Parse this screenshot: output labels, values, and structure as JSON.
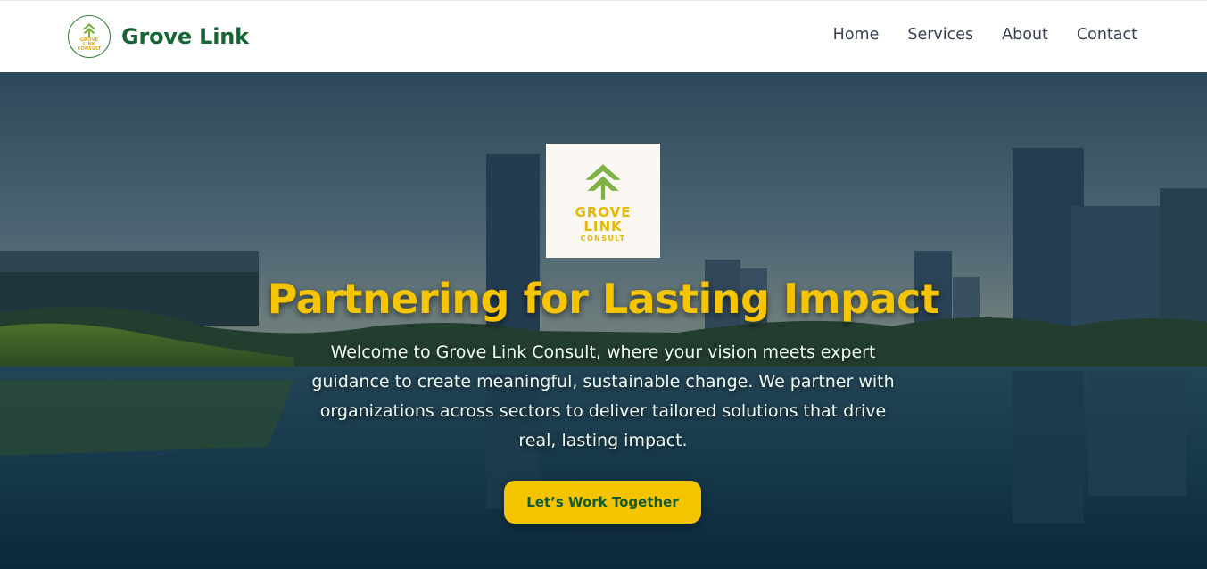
{
  "brand": {
    "name": "Grove Link",
    "badge_words": [
      "GROVE",
      "LINK",
      "CONSULT"
    ]
  },
  "nav": {
    "items": [
      "Home",
      "Services",
      "About",
      "Contact"
    ]
  },
  "hero": {
    "logo_words": [
      "GROVE",
      "LINK",
      "CONSULT"
    ],
    "title": "Partnering for Lasting Impact",
    "text": "Welcome to Grove Link Consult, where your vision meets expert guidance to create meaningful, sustainable change. We partner with organizations across sectors to deliver tailored solutions that drive real, lasting impact.",
    "cta_label": "Let’s Work Together"
  },
  "colors": {
    "brand_green": "#166534",
    "accent_yellow": "#f5c400",
    "nav_text": "#374151",
    "leaf_green": "#7cb342"
  },
  "icons": {
    "logo_mark": "tree-arrow-icon"
  }
}
